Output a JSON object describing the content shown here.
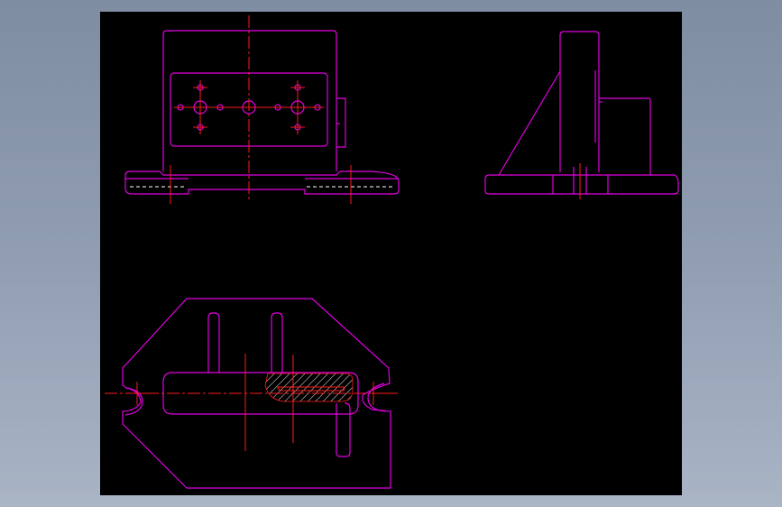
{
  "canvas": {
    "background": "#000000",
    "outline_color": "#e000e0",
    "centerline_color": "#ff1a1a",
    "hidden_line_color": "#ffffff",
    "frame_gradient": [
      "#7f8da3",
      "#a9b4c5"
    ]
  },
  "views": [
    {
      "id": "front",
      "label": ""
    },
    {
      "id": "side",
      "label": ""
    },
    {
      "id": "top",
      "label": ""
    }
  ]
}
